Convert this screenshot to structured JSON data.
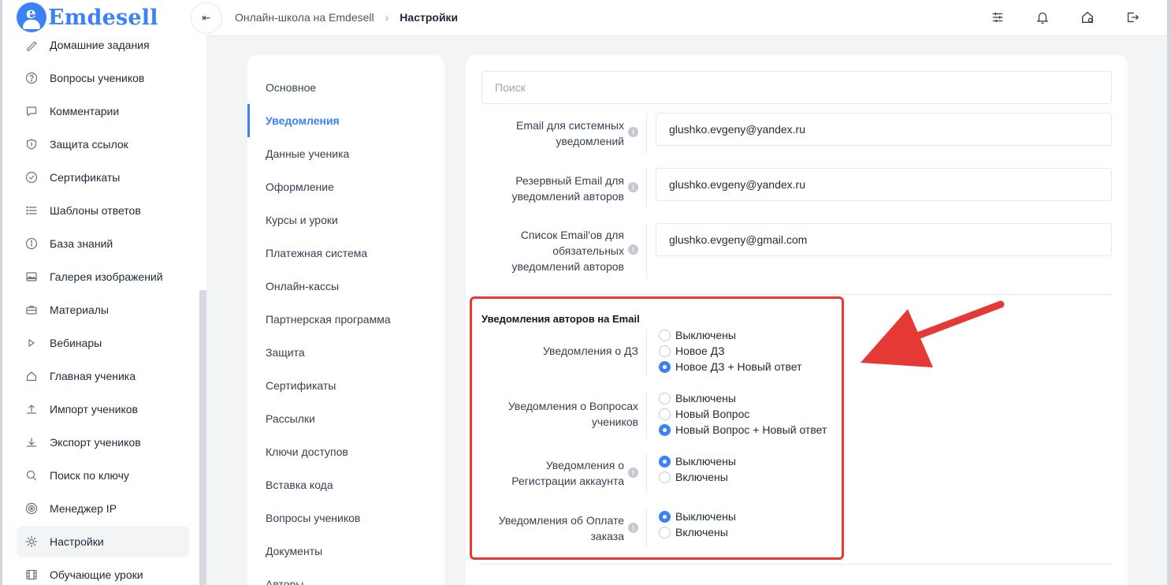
{
  "app": {
    "brand": "Emdesell",
    "colors": {
      "accent": "#3b82f6",
      "highlight": "#e53935"
    }
  },
  "sidebar": {
    "items": [
      {
        "label": "Домашние задания",
        "icon": "pencil-icon"
      },
      {
        "label": "Вопросы учеников",
        "icon": "question-icon"
      },
      {
        "label": "Комментарии",
        "icon": "comment-icon"
      },
      {
        "label": "Защита ссылок",
        "icon": "shield-icon"
      },
      {
        "label": "Сертификаты",
        "icon": "check-circle-icon"
      },
      {
        "label": "Шаблоны ответов",
        "icon": "list-icon"
      },
      {
        "label": "База знаний",
        "icon": "info-icon"
      },
      {
        "label": "Галерея изображений",
        "icon": "image-icon"
      },
      {
        "label": "Материалы",
        "icon": "briefcase-icon"
      },
      {
        "label": "Вебинары",
        "icon": "play-icon"
      },
      {
        "label": "Главная ученика",
        "icon": "home-icon"
      },
      {
        "label": "Импорт учеников",
        "icon": "upload-icon"
      },
      {
        "label": "Экспорт учеников",
        "icon": "download-icon"
      },
      {
        "label": "Поиск по ключу",
        "icon": "search-icon"
      },
      {
        "label": "Менеджер IP",
        "icon": "target-icon"
      },
      {
        "label": "Настройки",
        "icon": "gear-icon",
        "active": true
      },
      {
        "label": "Обучающие уроки",
        "icon": "film-icon"
      }
    ]
  },
  "header": {
    "breadcrumb": [
      "Онлайн-школа на Emdesell",
      "Настройки"
    ],
    "icons": [
      "sliders-icon",
      "bell-icon",
      "home-gear-icon",
      "logout-icon"
    ]
  },
  "settings_menu": {
    "items": [
      {
        "label": "Основное"
      },
      {
        "label": "Уведомления",
        "active": true
      },
      {
        "label": "Данные ученика"
      },
      {
        "label": "Оформление"
      },
      {
        "label": "Курсы и уроки"
      },
      {
        "label": "Платежная система"
      },
      {
        "label": "Онлайн-кассы"
      },
      {
        "label": "Партнерская программа"
      },
      {
        "label": "Защита"
      },
      {
        "label": "Сертификаты"
      },
      {
        "label": "Рассылки"
      },
      {
        "label": "Ключи доступов"
      },
      {
        "label": "Вставка кода"
      },
      {
        "label": "Вопросы учеников"
      },
      {
        "label": "Документы"
      },
      {
        "label": "Авторы"
      }
    ]
  },
  "main": {
    "search_placeholder": "Поиск",
    "email_fields": [
      {
        "label_lines": [
          "Email для системных",
          "уведомлений"
        ],
        "value": "glushko.evgeny@yandex.ru"
      },
      {
        "label_lines": [
          "Резервный Email для",
          "уведомлений авторов"
        ],
        "value": "glushko.evgeny@yandex.ru"
      },
      {
        "label_lines": [
          "Список Email'ов для",
          "обязательных",
          "уведомлений авторов"
        ],
        "value": "glushko.evgeny@gmail.com"
      }
    ],
    "section_title": "Уведомления авторов на Email",
    "radio_groups": [
      {
        "label_lines": [
          "Уведомления о ДЗ"
        ],
        "options": [
          "Выключены",
          "Новое ДЗ",
          "Новое ДЗ + Новый ответ"
        ],
        "selected": 2
      },
      {
        "label_lines": [
          "Уведомления о Вопросах",
          "учеников"
        ],
        "options": [
          "Выключены",
          "Новый Вопрос",
          "Новый Вопрос + Новый ответ"
        ],
        "selected": 2
      },
      {
        "label_lines": [
          "Уведомления о",
          "Регистрации аккаунта"
        ],
        "options": [
          "Выключены",
          "Включены"
        ],
        "selected": 0
      },
      {
        "label_lines": [
          "Уведомления об Оплате",
          "заказа"
        ],
        "options": [
          "Выключены",
          "Включены"
        ],
        "selected": 0
      }
    ],
    "next_label_partial": "........ .. . ........."
  }
}
